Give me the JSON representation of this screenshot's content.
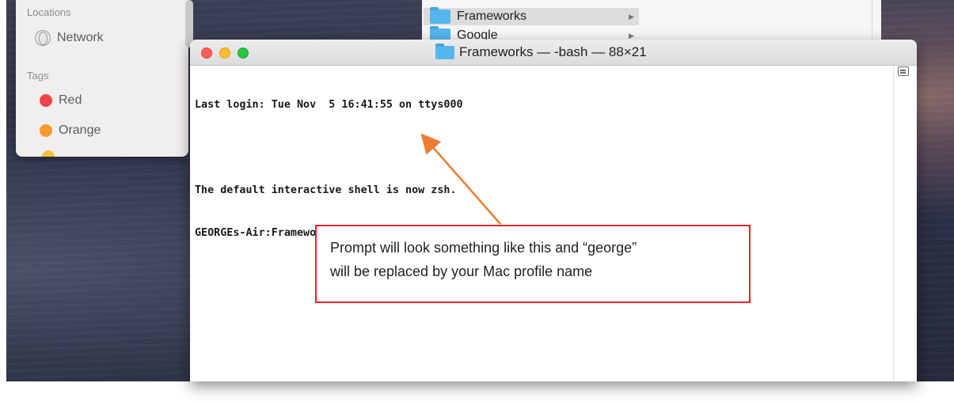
{
  "finder_sidebar": {
    "locations_label": "Locations",
    "network_label": "Network",
    "tags_label": "Tags",
    "tags": [
      {
        "label": "Red",
        "color": "#ef4444"
      },
      {
        "label": "Orange",
        "color": "#f59a2e"
      }
    ],
    "partial_tag_color": "#f2c23c"
  },
  "finder_column": {
    "items": [
      {
        "label": "Frameworks",
        "selected": true
      },
      {
        "label": "Google",
        "selected": false
      }
    ]
  },
  "terminal": {
    "title": "Frameworks — -bash — 88×21",
    "lines": [
      "Last login: Tue Nov  5 16:41:55 on ttys000",
      "",
      "The default interactive shell is now zsh.",
      "GEORGEs-Air:Frameworks george$"
    ]
  },
  "annotation": {
    "text_line1": "Prompt will look something like this and “george”",
    "text_line2": "will be replaced by your Mac profile name",
    "border_color": "#e0262b",
    "arrow_color": "#ed7d31"
  }
}
